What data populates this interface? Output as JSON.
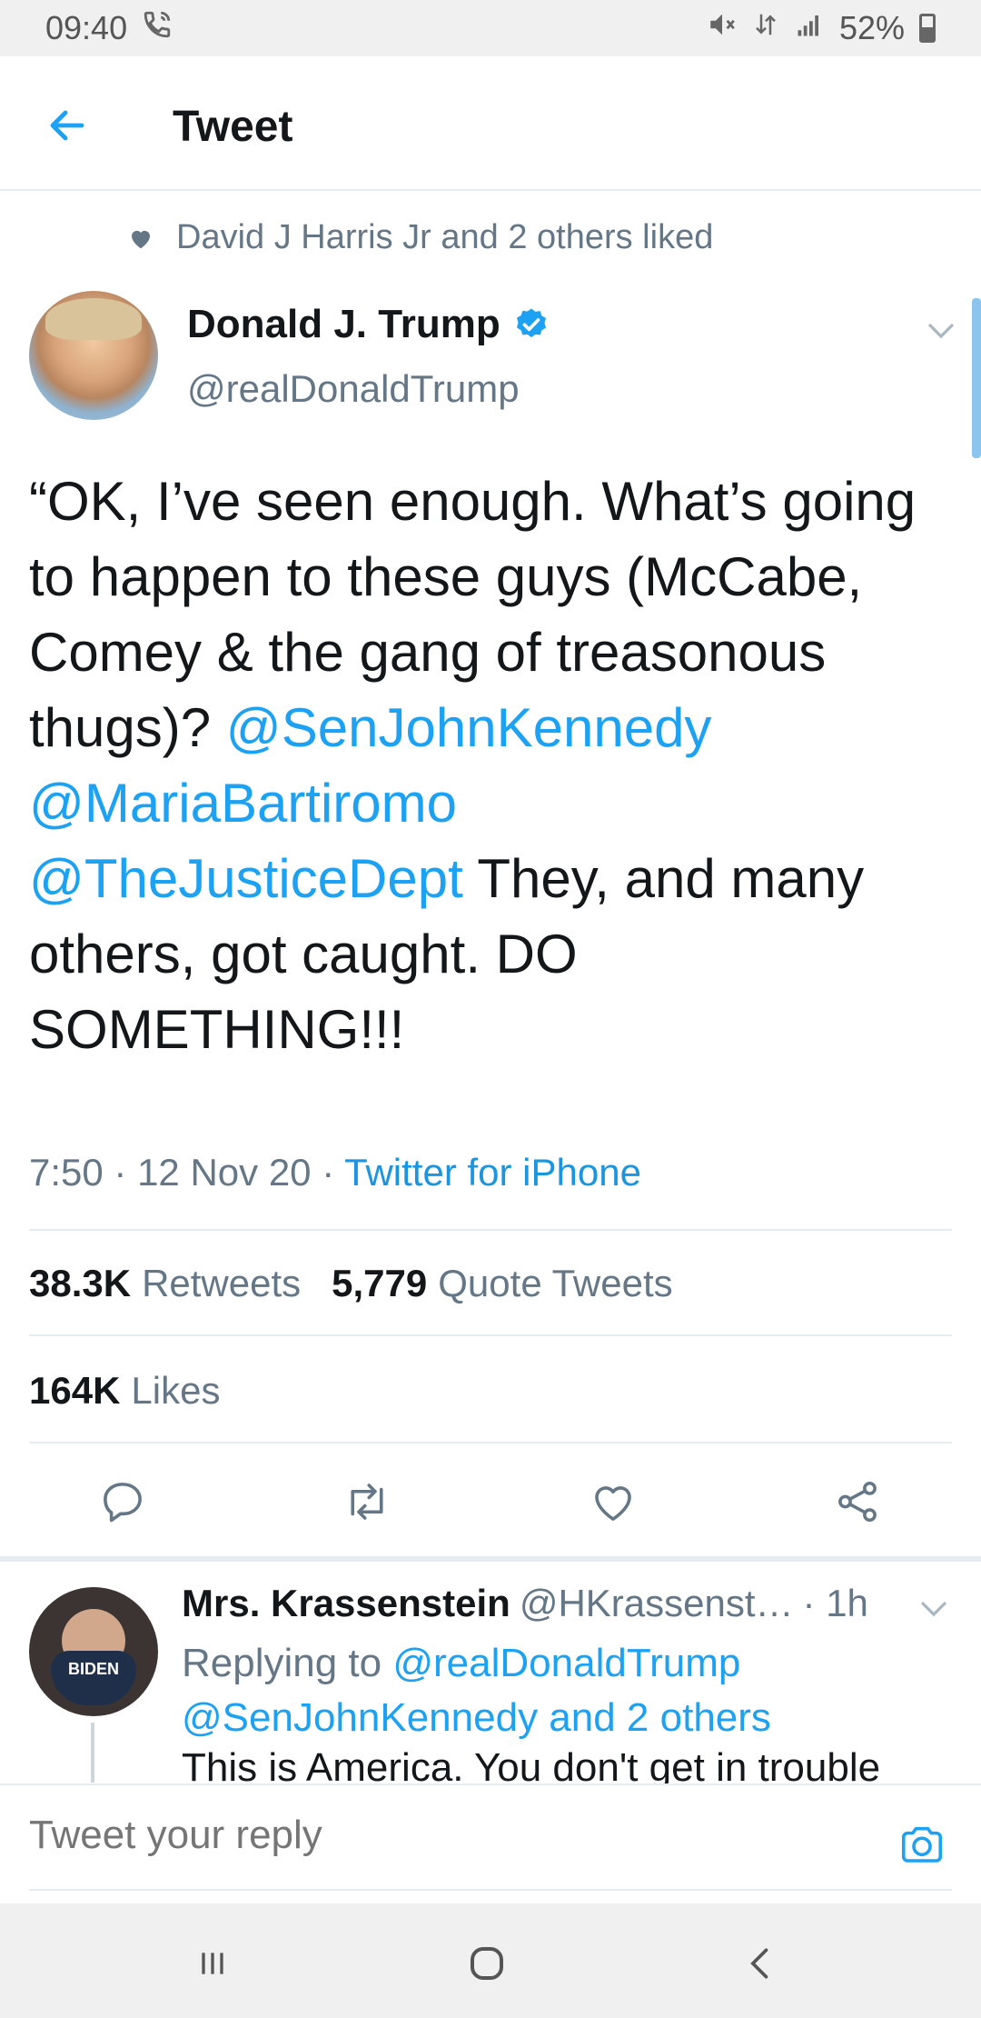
{
  "status_bar": {
    "time": "09:40",
    "battery": "52%",
    "icons": [
      "call-icon",
      "mute-icon",
      "data-icon",
      "signal-icon",
      "battery-icon"
    ]
  },
  "header": {
    "title": "Tweet"
  },
  "social_context": {
    "text": "David J Harris Jr and 2 others liked"
  },
  "tweet": {
    "author_name": "Donald J. Trump",
    "author_handle": "@realDonaldTrump",
    "text_part1": "“OK, I’ve seen enough. What’s going to happen to these guys (McCabe, Comey & the gang of treasonous thugs)? ",
    "mention1": "@SenJohnKennedy",
    "mention2": "@MariaBartiromo",
    "mention3": "@TheJusticeDept",
    "text_part2": " They, and many others, got caught. DO SOMETHING!!!",
    "time": "7:50",
    "date": "12 Nov 20",
    "source": "Twitter for iPhone",
    "retweets_count": "38.3K",
    "retweets_label": "Retweets",
    "quotes_count": "5,779",
    "quotes_label": "Quote Tweets",
    "likes_count": "164K",
    "likes_label": "Likes"
  },
  "reply": {
    "name": "Mrs. Krassenstein",
    "handle": "@HKrassenst…",
    "time": "· 1h",
    "replying_prefix": "Replying to ",
    "replying_mention": "@realDonaldTrump",
    "replying_rest": "@SenJohnKennedy and 2 others",
    "text": "This is America. You don't get in trouble",
    "mask_text": "BIDEN"
  },
  "composer": {
    "placeholder": "Tweet your reply"
  },
  "colors": {
    "accent": "#1da1f2",
    "secondary_text": "#657786",
    "divider": "#e6ecf0"
  }
}
